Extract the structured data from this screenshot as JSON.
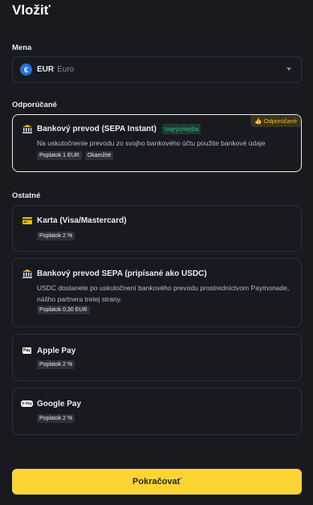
{
  "page": {
    "title": "Vložiť"
  },
  "currency_section": {
    "label": "Mena"
  },
  "currency": {
    "code": "EUR",
    "name": "Euro",
    "symbol": "€"
  },
  "recommended_section": {
    "label": "Odporúčané"
  },
  "recommended": {
    "title": "Bankový prevod (SEPA Instant)",
    "tag": "Najrýchlejšia",
    "badge": "👍 Odporúčané",
    "description": "Na uskutočnenie prevodu zo svojho bankového účtu použite bankové údaje",
    "pills": [
      "Poplatok 1 EUR",
      "Okamžité"
    ]
  },
  "other_section": {
    "label": "Ostatné"
  },
  "methods": [
    {
      "title": "Karta (Visa/Mastercard)",
      "pill": "Poplatok 2 %",
      "icon": "card-icon"
    },
    {
      "title": "Bankový prevod SEPA (pripísané ako USDC)",
      "description": "USDC dostanete po uskutočnení bankového prevodu prostredníctvom Paymonade, nášho partnera tretej strany.",
      "pill": "Poplatok 0,30 EUR",
      "icon": "bank-icon"
    },
    {
      "title": "Apple Pay",
      "pill": "Poplatok 2 %",
      "icon": "apple-pay-icon",
      "icon_text": "Pay"
    },
    {
      "title": "Google Pay",
      "pill": "Poplatok 2 %",
      "icon": "google-pay-icon",
      "icon_text": "G Pay"
    }
  ],
  "continue_button": {
    "label": "Pokračovať"
  },
  "colors": {
    "accent": "#fcd535",
    "background": "#181a20",
    "success": "#2ebd85",
    "card_border": "#2b3139"
  }
}
